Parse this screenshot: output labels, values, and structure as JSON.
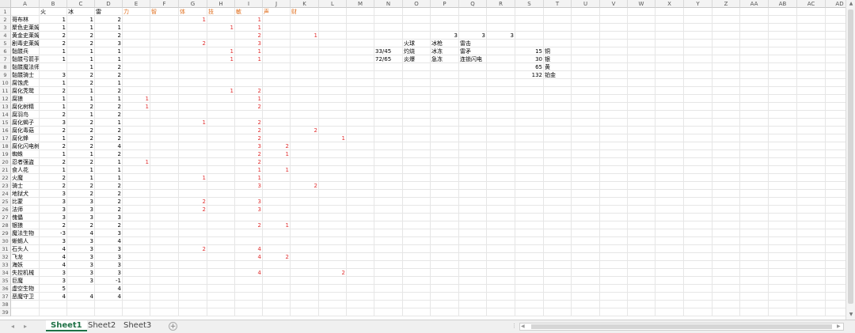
{
  "columns": [
    "A",
    "B",
    "C",
    "D",
    "E",
    "F",
    "G",
    "H",
    "I",
    "J",
    "K",
    "L",
    "M",
    "N",
    "O",
    "P",
    "Q",
    "R",
    "S",
    "T",
    "U",
    "V",
    "W",
    "X",
    "Y",
    "Z",
    "AA",
    "AB",
    "AC",
    "AD"
  ],
  "rows": [
    {
      "A": "",
      "B": "火",
      "C": "冰",
      "D": "雷",
      "E": "力",
      "F": "智",
      "G": "体",
      "H": "技",
      "I": "敏",
      "J": "声",
      "K": "财"
    },
    {
      "A": "哥布林",
      "B": "1",
      "C": "1",
      "D": "2",
      "G": "1",
      "I": "1"
    },
    {
      "A": "聚色史莱姆",
      "B": "1",
      "C": "1",
      "D": "1",
      "H": "1",
      "I": "1"
    },
    {
      "A": "黄金史莱姆",
      "B": "2",
      "C": "2",
      "D": "2",
      "I": "2",
      "K": "1",
      "P": "3",
      "Q": "3",
      "R": "3"
    },
    {
      "A": "剧毒史莱姆",
      "B": "2",
      "C": "2",
      "D": "3",
      "G": "2",
      "I": "3",
      "O": "火球",
      "P": "冰枪",
      "Q": "雷击"
    },
    {
      "A": "骷髅兵",
      "B": "1",
      "C": "1",
      "D": "1",
      "H": "1",
      "I": "1",
      "N": "33/45",
      "O": "灼烧",
      "P": "冰冻",
      "Q": "雷矛",
      "S": "15",
      "T": "铜"
    },
    {
      "A": "骷髅弓箭手",
      "B": "1",
      "C": "1",
      "D": "1",
      "H": "1",
      "I": "1",
      "N": "72/65",
      "O": "炎爆",
      "P": "急冻",
      "Q": "连锁闪电",
      "S": "30",
      "T": "银"
    },
    {
      "A": "骷髅魔法师",
      "C": "1",
      "D": "2",
      "S": "65",
      "T": "黄"
    },
    {
      "A": "骷髅骑士",
      "B": "3",
      "C": "2",
      "D": "2",
      "S": "132",
      "T": "铂金"
    },
    {
      "A": "腐蚀虎",
      "B": "1",
      "C": "2",
      "D": "1"
    },
    {
      "A": "腐化秃鹫",
      "B": "2",
      "C": "1",
      "D": "2",
      "H": "1",
      "I": "2"
    },
    {
      "A": "腐狼",
      "B": "1",
      "C": "1",
      "D": "1",
      "E": "1",
      "I": "1"
    },
    {
      "A": "腐化树精",
      "B": "1",
      "C": "2",
      "D": "2",
      "E": "1",
      "I": "2"
    },
    {
      "A": "腐羽鸟",
      "B": "2",
      "C": "1",
      "D": "2"
    },
    {
      "A": "腐化蝎子",
      "B": "3",
      "C": "2",
      "D": "1",
      "G": "1",
      "I": "2"
    },
    {
      "A": "腐化毒菇",
      "B": "2",
      "C": "2",
      "D": "2",
      "I": "2",
      "K": "2"
    },
    {
      "A": "腐化蜂",
      "B": "1",
      "C": "2",
      "D": "2",
      "I": "2",
      "L": "1"
    },
    {
      "A": "腐化闪电树",
      "B": "2",
      "C": "2",
      "D": "4",
      "I": "3",
      "J": "2"
    },
    {
      "A": "蜘蛛",
      "B": "1",
      "C": "1",
      "D": "2",
      "I": "2",
      "J": "1"
    },
    {
      "A": "忍者强盗",
      "B": "2",
      "C": "2",
      "D": "1",
      "E": "1",
      "I": "2"
    },
    {
      "A": "食人花",
      "B": "1",
      "C": "1",
      "D": "1",
      "I": "1",
      "J": "1"
    },
    {
      "A": "火魔",
      "B": "2",
      "C": "1",
      "D": "1",
      "G": "1",
      "I": "1"
    },
    {
      "A": "骑士",
      "B": "2",
      "C": "2",
      "D": "2",
      "I": "3",
      "K": "2"
    },
    {
      "A": "地狱犬",
      "B": "3",
      "C": "2",
      "D": "2"
    },
    {
      "A": "比蒙",
      "B": "3",
      "C": "3",
      "D": "2",
      "G": "2",
      "I": "3"
    },
    {
      "A": "法师",
      "B": "3",
      "C": "3",
      "D": "2",
      "G": "2",
      "I": "3"
    },
    {
      "A": "傀儡",
      "B": "3",
      "C": "3",
      "D": "3"
    },
    {
      "A": "银狼",
      "B": "2",
      "C": "2",
      "D": "2",
      "I": "2",
      "J": "1"
    },
    {
      "A": "魔法生物",
      "B": "-3",
      "C": "4",
      "D": "3"
    },
    {
      "A": "蜥蜴人",
      "B": "3",
      "C": "3",
      "D": "4"
    },
    {
      "A": "石头人",
      "B": "4",
      "C": "3",
      "D": "3",
      "G": "2",
      "I": "4"
    },
    {
      "A": "飞龙",
      "B": "4",
      "C": "3",
      "D": "3",
      "I": "4",
      "J": "2"
    },
    {
      "A": "海妖",
      "B": "4",
      "C": "3",
      "D": "3"
    },
    {
      "A": "失控机械",
      "B": "3",
      "C": "3",
      "D": "3",
      "I": "4",
      "L": "2"
    },
    {
      "A": "巨魔",
      "B": "3",
      "C": "3",
      "D": "-1"
    },
    {
      "A": "虚空生物",
      "B": "5",
      "D": "4"
    },
    {
      "A": "恶魔守卫",
      "B": "4",
      "C": "4",
      "D": "4"
    },
    {},
    {}
  ],
  "sheet_tabs": [
    {
      "label": "Sheet1",
      "active": true
    },
    {
      "label": "Sheet2",
      "active": false
    },
    {
      "label": "Sheet3",
      "active": false
    }
  ],
  "add_sheet_symbol": "+",
  "colors": {
    "header_text": "#e07020",
    "red_values": "#e03030",
    "active_tab": "#1e7145"
  }
}
